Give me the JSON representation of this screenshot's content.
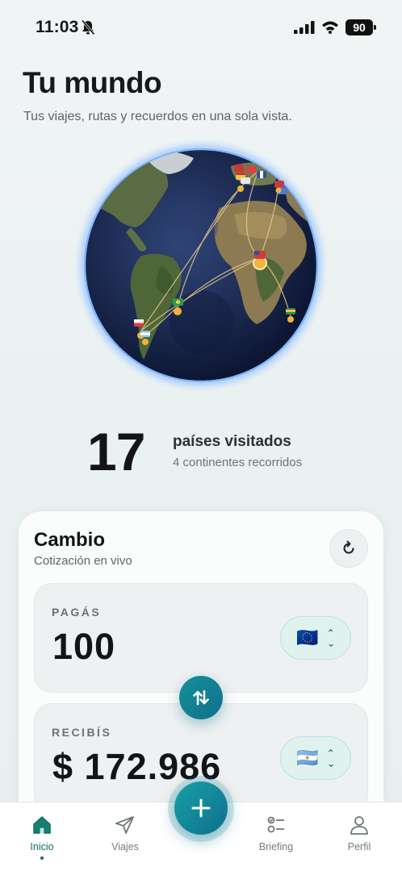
{
  "status": {
    "time": "11:03",
    "battery": "90"
  },
  "header": {
    "title": "Tu mundo",
    "subtitle": "Tus viajes, rutas y recuerdos en una sola vista."
  },
  "stats": {
    "count": "17",
    "label": "países visitados",
    "sub": "4 continentes recorridos"
  },
  "exchange": {
    "title": "Cambio",
    "subtitle": "Cotización en vivo",
    "pay": {
      "label": "PAGÁS",
      "amount": "100",
      "currency_flag": "🇪🇺"
    },
    "receive": {
      "label": "RECIBÍS",
      "amount": "$ 172.986",
      "currency_flag": "🇦🇷"
    }
  },
  "tabs": [
    {
      "label": "Inicio",
      "icon": "home-icon",
      "active": true
    },
    {
      "label": "Viajes",
      "icon": "send-icon",
      "active": false
    },
    {
      "label": "Briefing",
      "icon": "checklist-icon",
      "active": false
    },
    {
      "label": "Perfil",
      "icon": "user-icon",
      "active": false
    }
  ],
  "colors": {
    "accent": "#0f6f63",
    "fab": "#1389a0",
    "globe_glow": "#7fb6ff"
  }
}
